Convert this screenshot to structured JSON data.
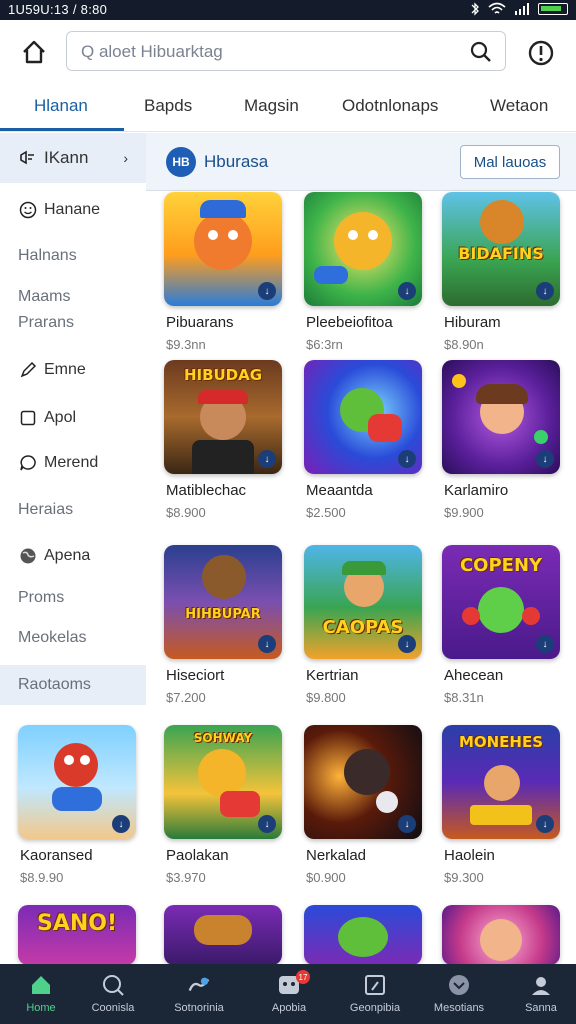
{
  "status": {
    "time": "1U59U:13 / 8:80"
  },
  "search": {
    "placeholder": "Q aloet Hibuarktag"
  },
  "tabs": [
    {
      "label": "Hlanan",
      "active": true
    },
    {
      "label": "Bapds"
    },
    {
      "label": "Magsin"
    },
    {
      "label": "Odotnlonaps"
    },
    {
      "label": "Wetaon"
    }
  ],
  "sidebar": {
    "items": [
      {
        "label": "IKann",
        "icon": "game-icon",
        "selected": true
      },
      {
        "label": "Hanane",
        "icon": "smiley-icon"
      },
      {
        "label": "Halnans"
      },
      {
        "label": "Maams"
      },
      {
        "label": "Prarans"
      },
      {
        "label": "Emne",
        "icon": "pen-icon"
      },
      {
        "label": "Apol",
        "icon": "square-icon"
      },
      {
        "label": "Merend",
        "icon": "chat-icon"
      },
      {
        "label": "Heraias"
      },
      {
        "label": "Apena",
        "icon": "globe-icon"
      },
      {
        "label": "Proms"
      },
      {
        "label": "Meokelas"
      },
      {
        "label": "Raotaoms",
        "selected": true
      }
    ]
  },
  "banner": {
    "title": "Hburasa",
    "logo_text": "HB",
    "button": "Mal lauoas"
  },
  "grid": [
    {
      "name": "Pibuarans",
      "price": "$9.3nn"
    },
    {
      "name": "Pleebeiofitoa",
      "price": "$6:3rn"
    },
    {
      "name": "Hiburam",
      "price": "$8.90n"
    },
    {
      "name": "Matiblechac",
      "price": "$8.900"
    },
    {
      "name": "Meaantda",
      "price": "$2.500"
    },
    {
      "name": "Karlamiro",
      "price": "$9.900"
    },
    {
      "name": "Hiseciort",
      "price": "$7.200"
    },
    {
      "name": "Kertrian",
      "price": "$9.800"
    },
    {
      "name": "Ahecean",
      "price": "$8.31n"
    },
    {
      "name": "Kaoransed",
      "price": "$8.9.90"
    },
    {
      "name": "Paolakan",
      "price": "$3.970"
    },
    {
      "name": "Nerkalad",
      "price": "$0.900"
    },
    {
      "name": "Haolein",
      "price": "$9.300"
    }
  ],
  "thumb_text": {
    "t3": "BIDAFINS",
    "t4": "HIBUDAG",
    "t7": "HIHBUPAR",
    "t8": "CAOPAS",
    "t9": "COPENY",
    "t13": "MONEHES",
    "t14": "SANO!"
  },
  "bottomnav": [
    {
      "label": "Home",
      "active": true
    },
    {
      "label": "Coonisla"
    },
    {
      "label": "Sotnorinia"
    },
    {
      "label": "Apobia",
      "badge": "17"
    },
    {
      "label": "Geonpibia"
    },
    {
      "label": "Mesotians"
    },
    {
      "label": "Sanna"
    }
  ],
  "colors": {
    "accent": "#1a5fa6",
    "nav_bg": "#1b2636",
    "active_nav": "#4fd18b"
  }
}
